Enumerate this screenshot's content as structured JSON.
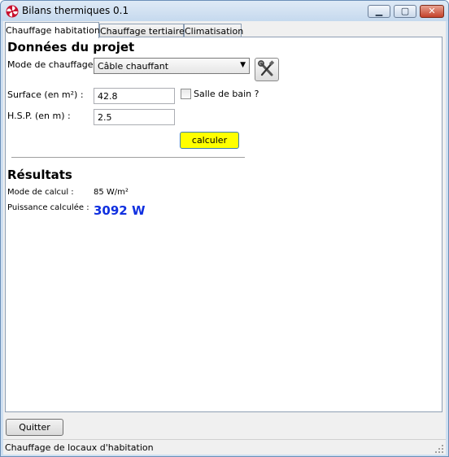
{
  "window": {
    "title": "Bilans thermiques 0.1"
  },
  "tabs": [
    {
      "label": "Chauffage habitation",
      "active": true
    },
    {
      "label": "Chauffage tertiaire",
      "active": false
    },
    {
      "label": "Climatisation",
      "active": false
    }
  ],
  "project": {
    "heading": "Données du projet",
    "mode_label": "Mode de chauffage :",
    "mode_value": "Câble chauffant",
    "surface_label": "Surface (en m²) :",
    "surface_value": "42.8",
    "salle_de_bain_label": "Salle de bain ?",
    "salle_de_bain_checked": false,
    "hsp_label": "H.S.P. (en m) :",
    "hsp_value": "2.5",
    "calc_button": "calculer"
  },
  "results": {
    "heading": "Résultats",
    "mode_calc_label": "Mode de calcul :",
    "mode_calc_value": "85 W/m²",
    "power_label": "Puissance calculée :",
    "power_value": "3092 W"
  },
  "footer": {
    "quit_button": "Quitter",
    "status_text": "Chauffage de locaux d'habitation"
  },
  "icons": {
    "app": "fan-icon",
    "tools": "tools-icon"
  },
  "colors": {
    "calc_button_bg": "#ffff00",
    "power_value": "#1030e0"
  }
}
